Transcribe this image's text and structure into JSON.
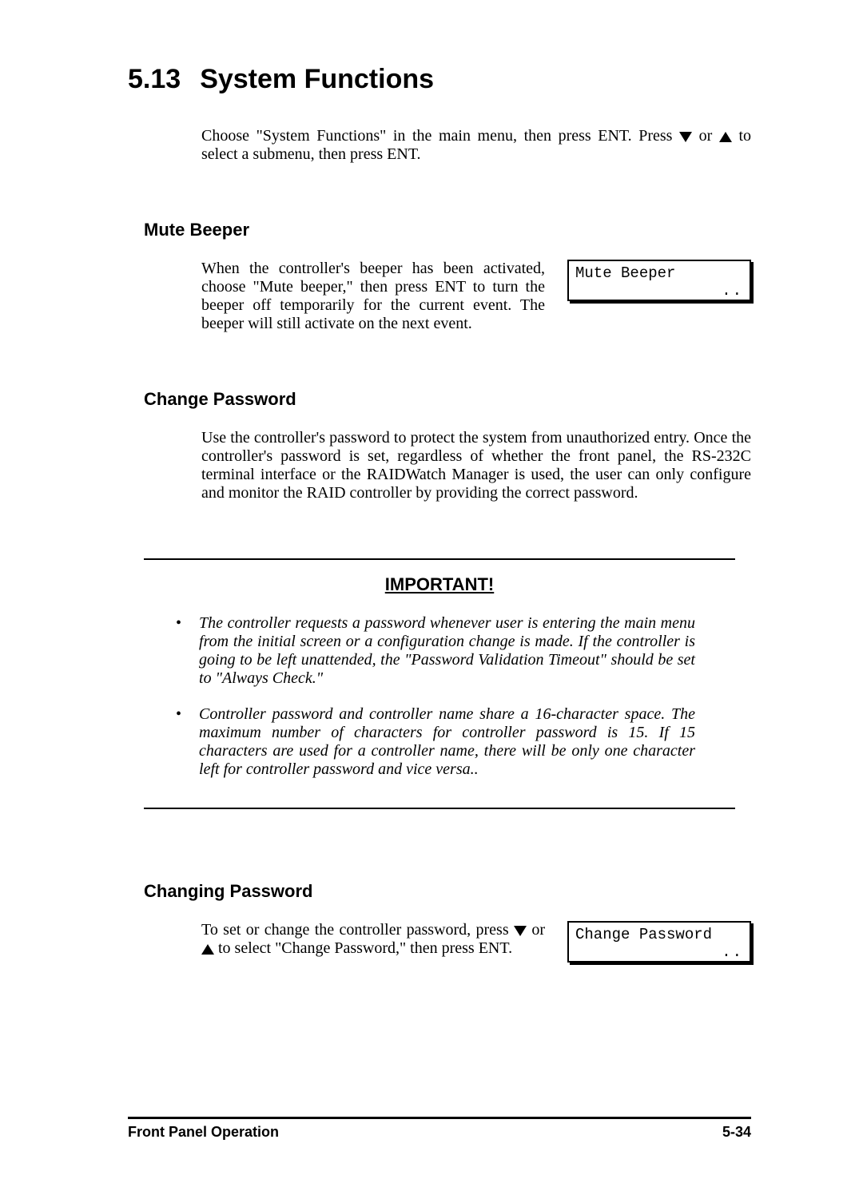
{
  "heading": {
    "number": "5.13",
    "title": "System Functions"
  },
  "intro": {
    "part1": "Choose \"System Functions\" in the main menu, then press ENT. Press ",
    "part2": " or ",
    "part3": " to select a submenu, then press ENT."
  },
  "mute": {
    "heading": "Mute Beeper",
    "text": "When the controller's beeper has been activated, choose \"Mute beeper,\" then press ENT to turn the beeper off temporarily for the current event. The beeper will still activate on the next event.",
    "lcd_line1": "Mute Beeper",
    "lcd_line2": ".."
  },
  "changepw": {
    "heading": "Change Password",
    "text": "Use the controller's password to protect the system from unauthorized entry.  Once the controller's password is set, regardless of whether the front panel, the RS-232C terminal interface or the RAIDWatch Manager is used, the user can only configure and monitor the RAID controller by providing the correct password."
  },
  "important": {
    "title": "IMPORTANT!",
    "items": [
      "The controller requests a password whenever user is entering the main menu from the initial screen or a configuration change is made.  If the controller is going to be left unattended, the \"Password Validation Timeout\" should be set to \"Always Check.\"",
      "Controller password and controller name share a 16-character space.  The maximum number of characters for controller password is 15.  If 15 characters are used for a controller name, there will be only one character left for controller password and vice versa.."
    ]
  },
  "changing": {
    "heading": "Changing Password",
    "part1": "To set or change the controller password, press ",
    "part2": " or ",
    "part3": " to select \"Change Password,\" then press ENT.",
    "lcd_line1": "Change Password",
    "lcd_line2": ".."
  },
  "footer": {
    "left": "Front Panel Operation",
    "right": "5-34"
  }
}
